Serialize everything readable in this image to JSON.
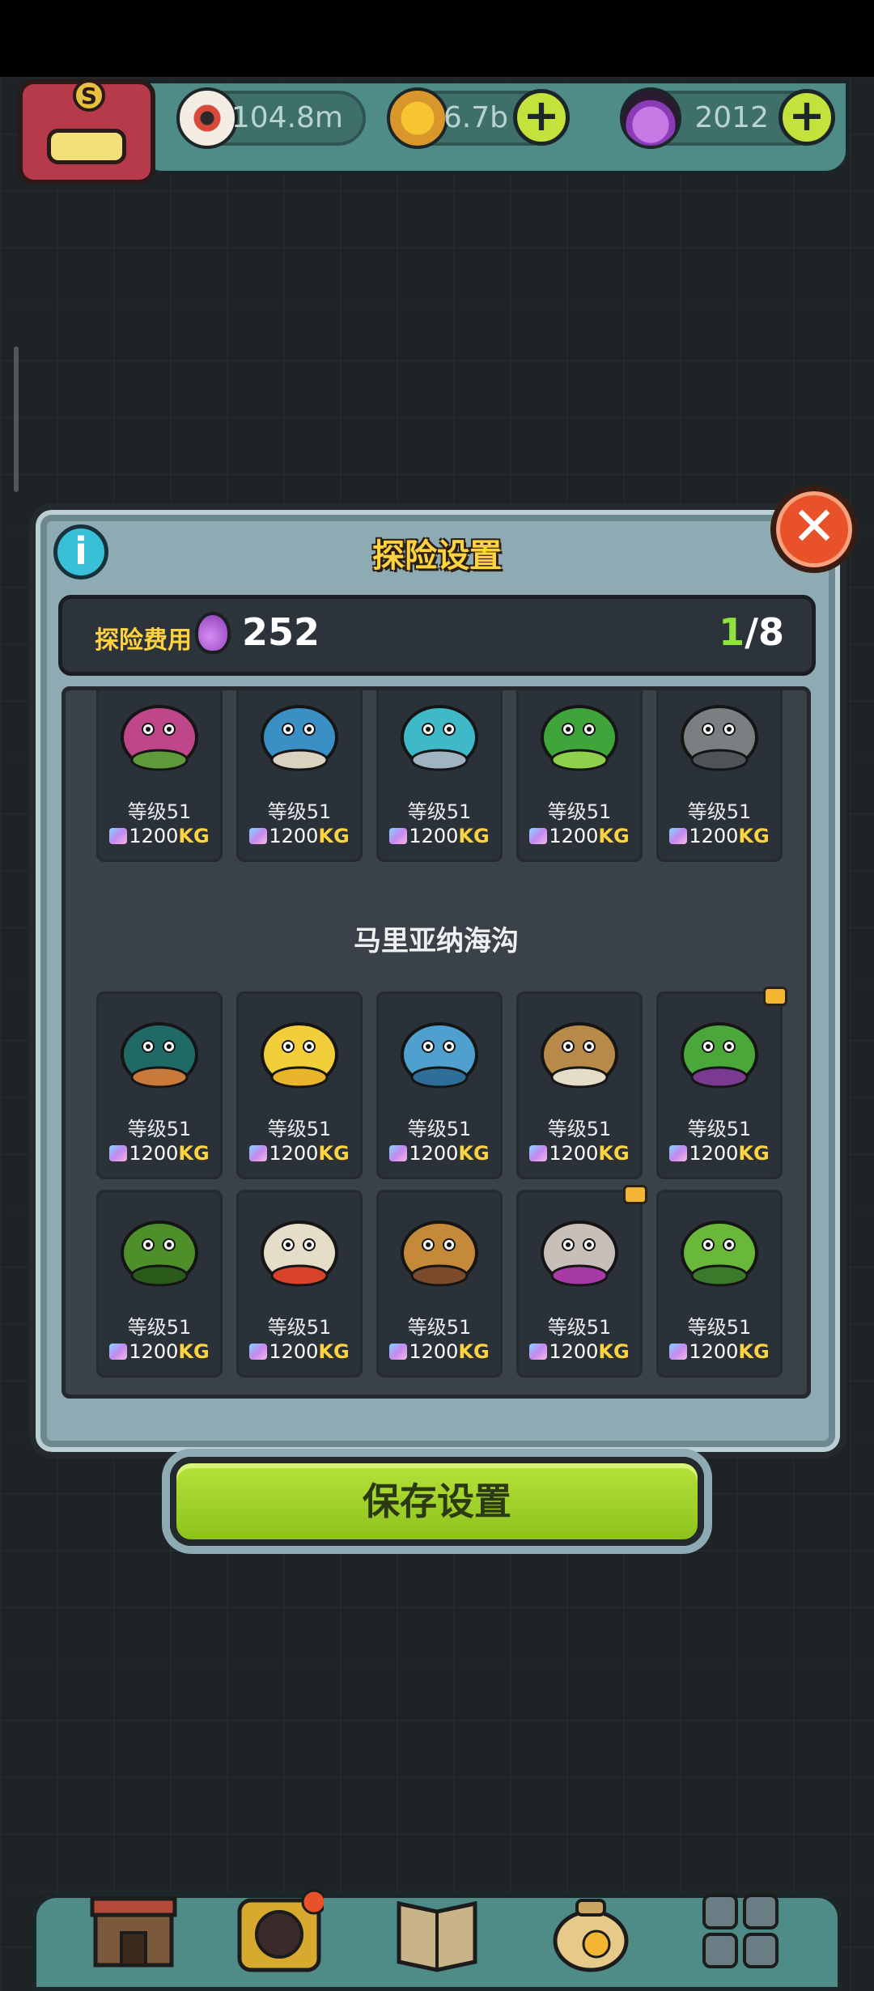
{
  "resources": [
    {
      "icon": "eyeball-icon",
      "value": "104.8m",
      "has_plus": false
    },
    {
      "icon": "gold-coin-icon",
      "value": "6.7b",
      "has_plus": true
    },
    {
      "icon": "potion-icon",
      "value": "2012",
      "has_plus": true
    }
  ],
  "avatar": {
    "letter": "S"
  },
  "modal": {
    "title": "探险设置",
    "cost_label": "探险费用",
    "cost_value": "252",
    "selected_current": "1",
    "selected_total": "/8",
    "save_label": "保存设置"
  },
  "section": {
    "title": "马里亚纳海沟"
  },
  "monsters_top": [
    {
      "level": "等级51",
      "weight": "1200",
      "unit": "KG",
      "icon": "onion-plant-monster-icon",
      "badge": true
    },
    {
      "level": "等级51",
      "weight": "1200",
      "unit": "KG",
      "icon": "snail-house-monster-icon",
      "badge": true
    },
    {
      "level": "等级51",
      "weight": "1200",
      "unit": "KG",
      "icon": "bubble-fish-monster-icon",
      "badge": false
    },
    {
      "level": "等级51",
      "weight": "1200",
      "unit": "KG",
      "icon": "green-caterpillar-monster-icon",
      "badge": false
    },
    {
      "level": "等级51",
      "weight": "1200",
      "unit": "KG",
      "icon": "rock-golem-monster-icon",
      "badge": false
    }
  ],
  "monsters_row1": [
    {
      "level": "等级51",
      "weight": "1200",
      "unit": "KG",
      "icon": "urchin-monster-icon",
      "badge": false
    },
    {
      "level": "等级51",
      "weight": "1200",
      "unit": "KG",
      "icon": "banana-squid-monster-icon",
      "badge": false
    },
    {
      "level": "等级51",
      "weight": "1200",
      "unit": "KG",
      "icon": "blue-crab-monster-icon",
      "badge": false
    },
    {
      "level": "等级51",
      "weight": "1200",
      "unit": "KG",
      "icon": "walrus-shell-monster-icon",
      "badge": false
    },
    {
      "level": "等级51",
      "weight": "1200",
      "unit": "KG",
      "icon": "mantis-monster-icon",
      "badge": true
    }
  ],
  "monsters_row2": [
    {
      "level": "等级51",
      "weight": "1200",
      "unit": "KG",
      "icon": "green-worm-monster-icon",
      "badge": false
    },
    {
      "level": "等级51",
      "weight": "1200",
      "unit": "KG",
      "icon": "clam-claw-monster-icon",
      "badge": false
    },
    {
      "level": "等级51",
      "weight": "1200",
      "unit": "KG",
      "icon": "dragon-shrimp-monster-icon",
      "badge": false
    },
    {
      "level": "等级51",
      "weight": "1200",
      "unit": "KG",
      "icon": "oyster-octopus-monster-icon",
      "badge": true
    },
    {
      "level": "等级51",
      "weight": "1200",
      "unit": "KG",
      "icon": "seahorse-monster-icon",
      "badge": false
    }
  ],
  "nav": [
    {
      "icon": "shop-building-icon"
    },
    {
      "icon": "monster-lair-icon"
    },
    {
      "icon": "book-icon"
    },
    {
      "icon": "money-bag-icon"
    },
    {
      "icon": "grid-menu-icon"
    }
  ],
  "colors": {
    "accent_yellow": "#ffd23f",
    "accent_green": "#8fe43b",
    "button_green": "#a6d82c"
  }
}
